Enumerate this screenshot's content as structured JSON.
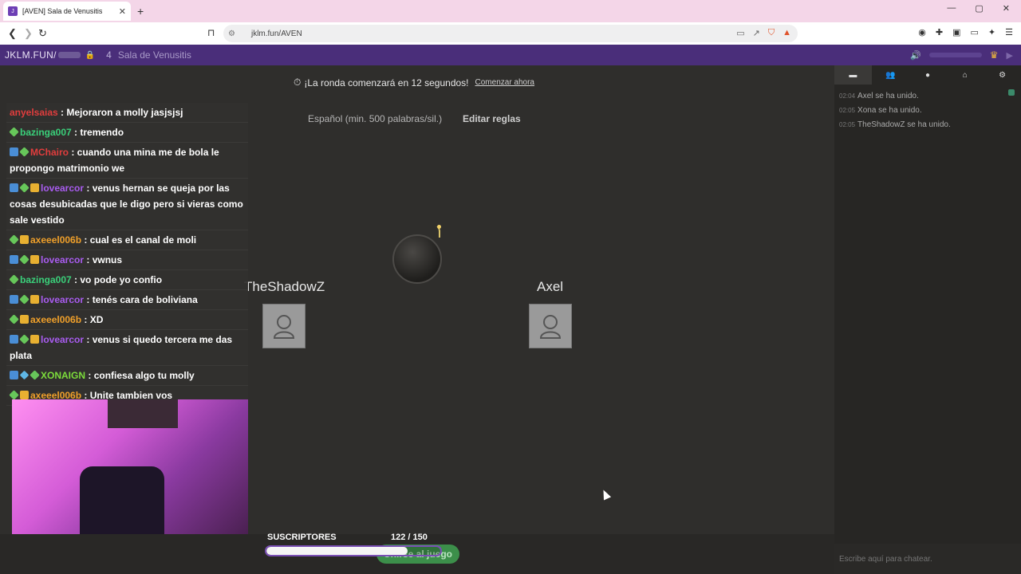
{
  "browser": {
    "tab_title": "[AVEN] Sala de Venusitis",
    "favicon_label": "J",
    "new_tab": "+",
    "url": "jklm.fun/AVEN",
    "window_controls": [
      "—",
      "▢",
      "✕"
    ]
  },
  "header": {
    "site": "JKLM.FUN/",
    "player_count": "4",
    "room_name": "Sala de Venusitis"
  },
  "game": {
    "banner_text": "¡La ronda comenzará en 12 segundos!",
    "start_now": "Comenzar ahora",
    "rules_text": "Español (min. 500 palabras/sil.)",
    "edit_rules": "Editar reglas",
    "player_left": "TheShadowZ",
    "player_right": "Axel",
    "join_button": "Unirse al juego"
  },
  "subs": {
    "label": "SUSCRIPTORES",
    "count": "122  / 150",
    "current": 122,
    "goal": 150
  },
  "chat_overlay": [
    {
      "badges": [],
      "user": "anyelsaias",
      "color": "red",
      "text": "Mejoraron a molly jasjsjsj"
    },
    {
      "badges": [
        "sub"
      ],
      "user": "bazinga007",
      "color": "green",
      "text": "tremendo"
    },
    {
      "badges": [
        "mod",
        "sub"
      ],
      "user": "MChairo",
      "color": "red",
      "text": "cuando una mina me de bola le propongo matrimonio we"
    },
    {
      "badges": [
        "mod",
        "sub",
        "vip"
      ],
      "user": "lovearcor",
      "color": "purple",
      "text": "venus hernan se queja por las cosas desubicadas que le digo pero si vieras como sale vestido"
    },
    {
      "badges": [
        "sub",
        "vip"
      ],
      "user": "axeeel006b",
      "color": "orange",
      "text": "cual es el canal de moli"
    },
    {
      "badges": [
        "mod",
        "sub",
        "vip"
      ],
      "user": "lovearcor",
      "color": "purple",
      "text": "vwnus"
    },
    {
      "badges": [
        "sub"
      ],
      "user": "bazinga007",
      "color": "green",
      "text": "vo pode yo confio"
    },
    {
      "badges": [
        "mod",
        "sub",
        "vip"
      ],
      "user": "lovearcor",
      "color": "purple",
      "text": "tenés cara de boliviana"
    },
    {
      "badges": [
        "sub",
        "vip"
      ],
      "user": "axeeel006b",
      "color": "orange",
      "text": "XD"
    },
    {
      "badges": [
        "mod",
        "sub",
        "vip"
      ],
      "user": "lovearcor",
      "color": "purple",
      "text": "venus si quedo tercera me das plata"
    },
    {
      "badges": [
        "mod",
        "gem",
        "sub"
      ],
      "user": "XONAIGN",
      "color": "lime",
      "text": "confiesa algo tu molly"
    },
    {
      "badges": [
        "sub",
        "vip"
      ],
      "user": "axeeel006b",
      "color": "orange",
      "text": "Unite tambien vos"
    }
  ],
  "sidebar": {
    "tabs": [
      "chat-icon",
      "players-icon",
      "bomb-icon",
      "home-icon",
      "settings-icon"
    ],
    "log": [
      {
        "time": "02:04",
        "text": "Axel se ha unido."
      },
      {
        "time": "02:05",
        "text": "Xona se ha unido."
      },
      {
        "time": "02:05",
        "text": "TheShadowZ se ha unido."
      }
    ],
    "chat_placeholder": "Escribe aquí para chatear."
  },
  "colors": {
    "header_bg": "#4a2e7a",
    "tab_bar_bg": "#f4d6e8",
    "join_green": "#3c8f4a"
  }
}
